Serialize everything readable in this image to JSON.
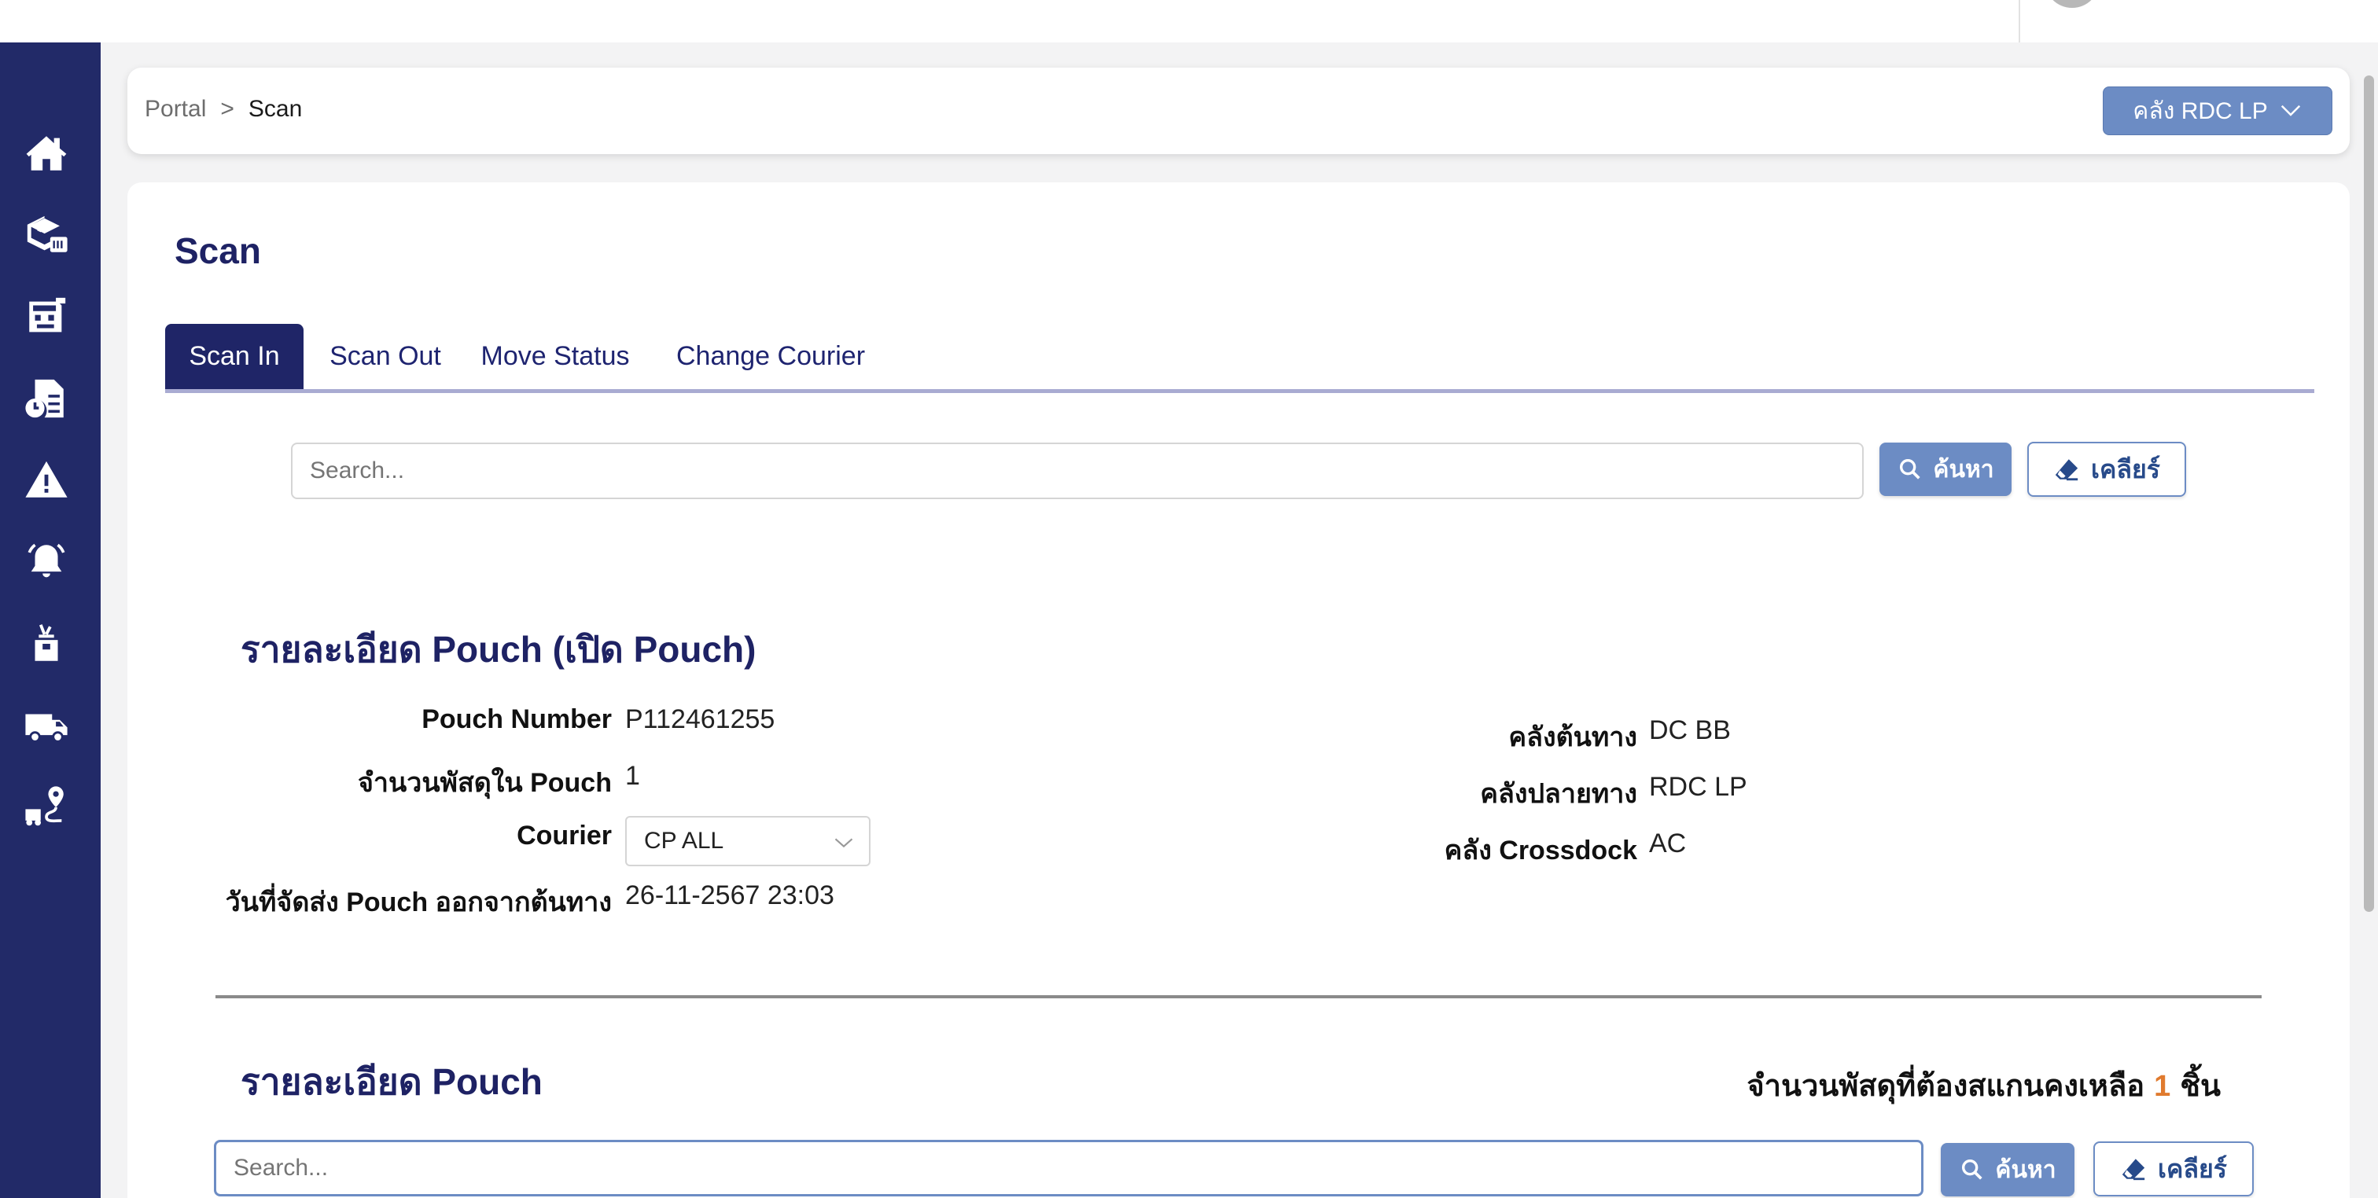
{
  "breadcrumb": {
    "root": "Portal",
    "separator": ">",
    "current": "Scan"
  },
  "warehouse_selector": {
    "label": "คลัง RDC LP"
  },
  "page": {
    "title": "Scan"
  },
  "tabs": [
    {
      "label": "Scan In",
      "active": true
    },
    {
      "label": "Scan Out",
      "active": false
    },
    {
      "label": "Move Status",
      "active": false
    },
    {
      "label": "Change Courier",
      "active": false
    }
  ],
  "top_search": {
    "placeholder": "Search...",
    "search_label": "ค้นหา",
    "clear_label": "เคลียร์"
  },
  "pouch_open": {
    "title": "รายละเอียด Pouch (เปิด Pouch)",
    "pouch_number_label": "Pouch Number",
    "pouch_number": "P112461255",
    "parcel_count_label": "จำนวนพัสดุใน Pouch",
    "parcel_count": "1",
    "courier_label": "Courier",
    "courier_value": "CP ALL",
    "ship_date_label": "วันที่จัดส่ง Pouch ออกจากต้นทาง",
    "ship_date": "26-11-2567 23:03",
    "origin_label": "คลังต้นทาง",
    "origin": "DC BB",
    "destination_label": "คลังปลายทาง",
    "destination": "RDC LP",
    "crossdock_label": "คลัง Crossdock",
    "crossdock": "AC"
  },
  "pouch_detail": {
    "title": "รายละเอียด Pouch",
    "remaining_label": "จำนวนพัสดุที่ต้องสแกนคงเหลือ",
    "remaining_count": "1",
    "remaining_unit": "ชิ้น",
    "search_placeholder": "Search...",
    "search_label": "ค้นหา",
    "clear_label": "เคลียร์"
  },
  "sidebar_icons": [
    "home-icon",
    "package-icon",
    "store-icon",
    "report-icon",
    "warning-icon",
    "bell-icon",
    "parcel-hand-icon",
    "truck-icon",
    "route-icon"
  ],
  "colors": {
    "sidebar": "#222a68",
    "accent": "#6c8cc4",
    "title": "#1e2264",
    "highlight": "#e07a2e"
  }
}
